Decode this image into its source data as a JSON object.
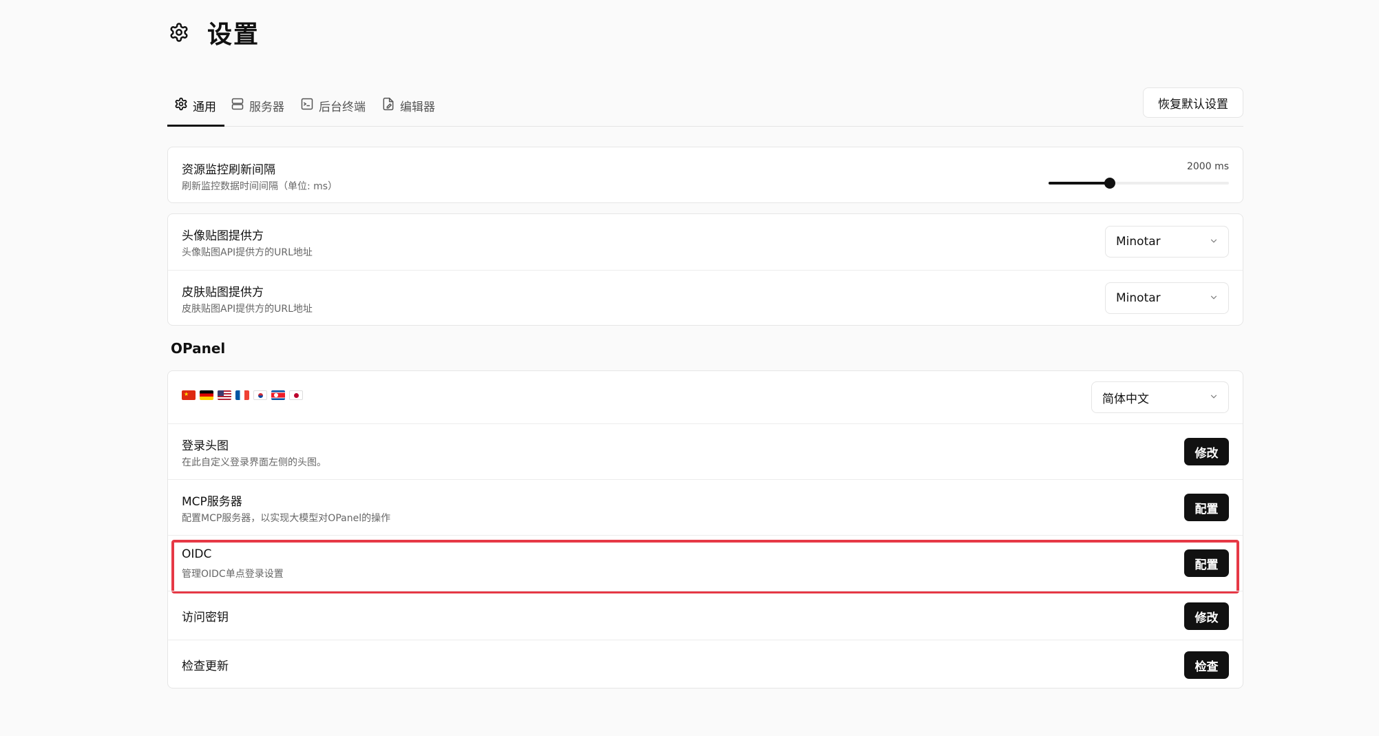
{
  "header": {
    "title": "设置",
    "icon": "gear-icon"
  },
  "tabs": [
    {
      "label": "通用",
      "icon": "gear-icon",
      "active": true
    },
    {
      "label": "服务器",
      "icon": "server-icon",
      "active": false
    },
    {
      "label": "后台终端",
      "icon": "terminal-icon",
      "active": false
    },
    {
      "label": "编辑器",
      "icon": "file-edit-icon",
      "active": false
    }
  ],
  "reset_label": "恢复默认设置",
  "monitor": {
    "title": "资源监控刷新间隔",
    "desc": "刷新监控数据时间间隔（单位: ms）",
    "value_text": "2000 ms",
    "slider_fraction": 0.34
  },
  "avatar_provider": {
    "title": "头像贴图提供方",
    "desc": "头像贴图API提供方的URL地址",
    "selected": "Minotar"
  },
  "skin_provider": {
    "title": "皮肤贴图提供方",
    "desc": "皮肤贴图API提供方的URL地址",
    "selected": "Minotar"
  },
  "opanel": {
    "section_title": "OPanel",
    "language": {
      "flags": [
        "cn-flag",
        "de-flag",
        "us-flag",
        "fr-flag",
        "kr-flag",
        "kp-flag",
        "jp-flag"
      ],
      "selected": "简体中文"
    },
    "login_image": {
      "title": "登录头图",
      "desc": "在此自定义登录界面左侧的头图。",
      "button": "修改"
    },
    "mcp": {
      "title": "MCP服务器",
      "desc": "配置MCP服务器，以实现大模型对OPanel的操作",
      "button": "配置"
    },
    "oidc": {
      "title": "OIDC",
      "desc": "管理OIDC单点登录设置",
      "button": "配置"
    },
    "access_key": {
      "title": "访问密钥",
      "button": "修改"
    },
    "update": {
      "title": "检查更新",
      "button": "检查"
    }
  },
  "colors": {
    "accent": "#111111",
    "highlight": "#e63946",
    "background": "#fafafa"
  }
}
